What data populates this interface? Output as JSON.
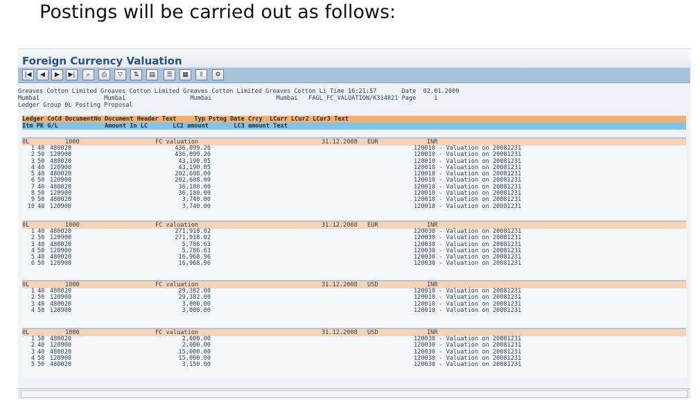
{
  "slide": {
    "title": "Postings will be carried out as follows:"
  },
  "sap": {
    "title": "Foreign Currency Valuation",
    "toolbar": [
      {
        "name": "first-page-icon",
        "glyph": "|◀"
      },
      {
        "name": "previous-page-icon",
        "glyph": "◀"
      },
      {
        "name": "next-page-icon",
        "glyph": "▶"
      },
      {
        "name": "last-page-icon",
        "glyph": "▶|"
      },
      {
        "name": "find-icon",
        "glyph": "⌕"
      },
      {
        "name": "print-icon",
        "glyph": "⎙"
      },
      {
        "name": "filter-icon",
        "glyph": "▽"
      },
      {
        "name": "sort-icon",
        "glyph": "⇅"
      },
      {
        "name": "layout-icon",
        "glyph": "▤"
      },
      {
        "name": "details-icon",
        "glyph": "☰"
      },
      {
        "name": "spreadsheet-icon",
        "glyph": "▦"
      },
      {
        "name": "export-icon",
        "glyph": "⇪"
      },
      {
        "name": "settings-icon",
        "glyph": "⚙"
      }
    ],
    "meta": {
      "line1": "Greaves Cotton Limited Greaves Cotton Limited Greaves Cotton Limited Greaves Cotton Li Time 16:21:57       Date  02.01.2009",
      "line2": "Mumbai                  Mumbai                  Mumbai                  Mumbai   FAGL_FC_VALUATION/K314821 Page     1",
      "line3": "Ledger Group 0L Posting Proposal"
    },
    "headers": {
      "line1": "Ledger CoCd DocumentNo Document Header Text     Typ Pstng Date Crcy  LCurr LCur2 LCur3 Text",
      "line2": "Itm PK G/L             Amount In LC       LC2 amount       LC3 amount Text"
    },
    "blocks": [
      {
        "header": {
          "ledger": "0L",
          "cocd": "1000",
          "text": "FC valuation",
          "date": "31.12.2008",
          "crcy": "EUR",
          "lcurr": "INR"
        },
        "rows": [
          {
            "itm": "1",
            "pk": "40",
            "gl": "480020",
            "amount": "436,099.26",
            "text": "120010 - Valuation on 20081231"
          },
          {
            "itm": "2",
            "pk": "50",
            "gl": "120900",
            "amount": "436,099.26",
            "text": "120010 - Valuation on 20081231"
          },
          {
            "itm": "3",
            "pk": "50",
            "gl": "480020",
            "amount": "43,190.05",
            "text": "120010 - Valuation on 20081231"
          },
          {
            "itm": "4",
            "pk": "40",
            "gl": "120900",
            "amount": "43,190.05",
            "text": "120010 - Valuation on 20081231"
          },
          {
            "itm": "5",
            "pk": "40",
            "gl": "480020",
            "amount": "202,608.00",
            "text": "120010 - Valuation on 20081231"
          },
          {
            "itm": "6",
            "pk": "50",
            "gl": "120900",
            "amount": "202,608.00",
            "text": "120010 - Valuation on 20081231"
          },
          {
            "itm": "7",
            "pk": "40",
            "gl": "480020",
            "amount": "36,180.00",
            "text": "120010 - Valuation on 20081231"
          },
          {
            "itm": "8",
            "pk": "50",
            "gl": "120900",
            "amount": "36,180.00",
            "text": "120010 - Valuation on 20081231"
          },
          {
            "itm": "9",
            "pk": "50",
            "gl": "480020",
            "amount": "3,740.00",
            "text": "120010 - Valuation on 20081231"
          },
          {
            "itm": "10",
            "pk": "40",
            "gl": "120900",
            "amount": "3,740.00",
            "text": "120010 - Valuation on 20081231"
          }
        ]
      },
      {
        "header": {
          "ledger": "0L",
          "cocd": "1000",
          "text": "FC valuation",
          "date": "31.12.2008",
          "crcy": "EUR",
          "lcurr": "INR"
        },
        "rows": [
          {
            "itm": "1",
            "pk": "40",
            "gl": "480020",
            "amount": "271,918.02",
            "text": "120030 - Valuation on 20081231"
          },
          {
            "itm": "2",
            "pk": "50",
            "gl": "120900",
            "amount": "271,918.02",
            "text": "120030 - Valuation on 20081231"
          },
          {
            "itm": "3",
            "pk": "40",
            "gl": "480020",
            "amount": "5,786.63",
            "text": "120030 - Valuation on 20081231"
          },
          {
            "itm": "4",
            "pk": "50",
            "gl": "120900",
            "amount": "5,786.63",
            "text": "120030 - Valuation on 20081231"
          },
          {
            "itm": "5",
            "pk": "40",
            "gl": "480020",
            "amount": "16,968.96",
            "text": "120030 - Valuation on 20081231"
          },
          {
            "itm": "6",
            "pk": "50",
            "gl": "120900",
            "amount": "16,968.96",
            "text": "120030 - Valuation on 20081231"
          }
        ]
      },
      {
        "header": {
          "ledger": "0L",
          "cocd": "1000",
          "text": "FC valuation",
          "date": "31.12.2008",
          "crcy": "USD",
          "lcurr": "INR"
        },
        "rows": [
          {
            "itm": "1",
            "pk": "40",
            "gl": "480020",
            "amount": "29,382.00",
            "text": "120010 - Valuation on 20081231"
          },
          {
            "itm": "2",
            "pk": "50",
            "gl": "120900",
            "amount": "29,382.00",
            "text": "120010 - Valuation on 20081231"
          },
          {
            "itm": "3",
            "pk": "40",
            "gl": "480020",
            "amount": "3,000.00",
            "text": "120010 - Valuation on 20081231"
          },
          {
            "itm": "4",
            "pk": "50",
            "gl": "120900",
            "amount": "3,000.00",
            "text": "120010 - Valuation on 20081231"
          }
        ]
      },
      {
        "header": {
          "ledger": "0L",
          "cocd": "1000",
          "text": "FC valuation",
          "date": "31.12.2008",
          "crcy": "USD",
          "lcurr": "INR"
        },
        "rows": [
          {
            "itm": "1",
            "pk": "50",
            "gl": "480020",
            "amount": "2,000.00",
            "text": "120030 - Valuation on 20081231"
          },
          {
            "itm": "2",
            "pk": "40",
            "gl": "120900",
            "amount": "2,000.00",
            "text": "120030 - Valuation on 20081231"
          },
          {
            "itm": "3",
            "pk": "40",
            "gl": "480020",
            "amount": "15,000.00",
            "text": "120030 - Valuation on 20081231"
          },
          {
            "itm": "4",
            "pk": "50",
            "gl": "120900",
            "amount": "15,000.00",
            "text": "120030 - Valuation on 20081231"
          },
          {
            "itm": "5",
            "pk": "50",
            "gl": "480020",
            "amount": "3,150.00",
            "text": "120030 - Valuation on 20081231"
          }
        ]
      }
    ]
  }
}
